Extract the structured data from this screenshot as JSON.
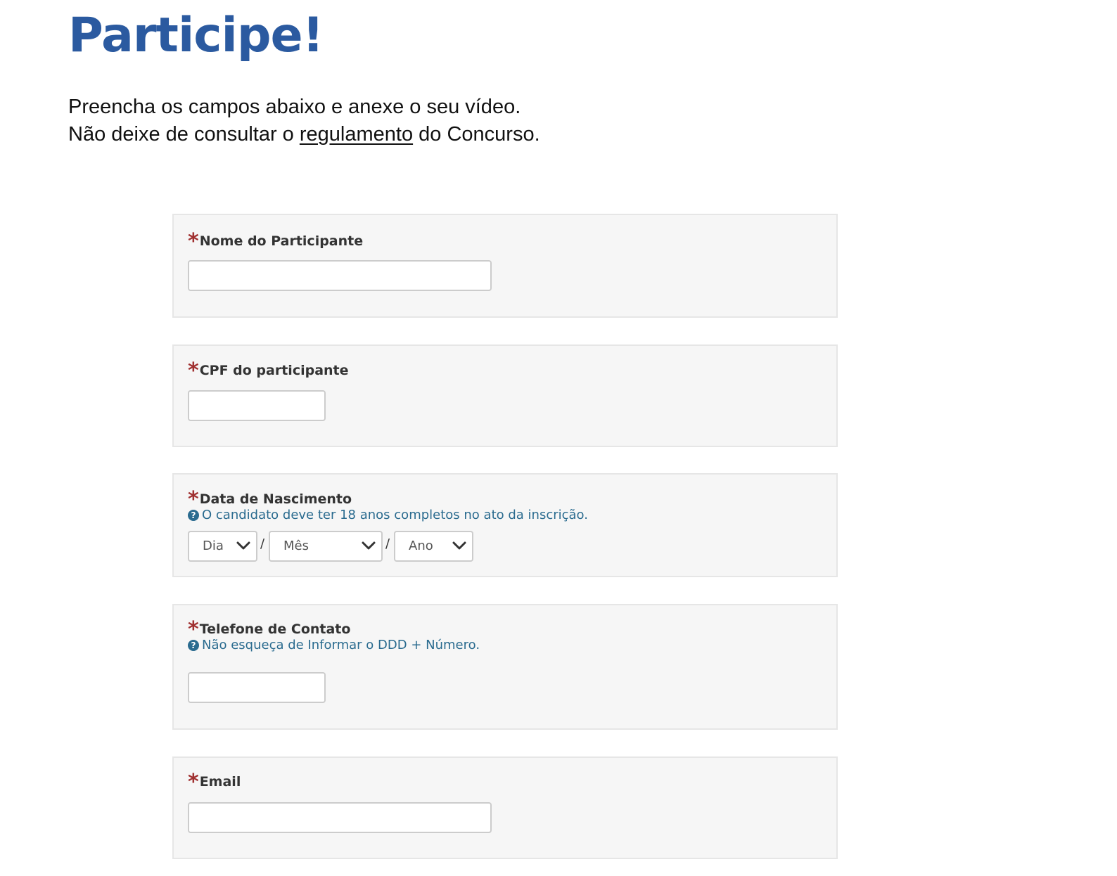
{
  "page": {
    "title": "Participe!",
    "intro_line1": "Preencha os campos abaixo e anexe o seu vídeo.",
    "intro_line2_prefix": "Não deixe de consultar o ",
    "intro_line2_link": "regulamento",
    "intro_line2_suffix": " do Concurso."
  },
  "form": {
    "required_marker": "*",
    "help_icon": "question-circle-icon",
    "fields": {
      "nome": {
        "label": "Nome do Participante",
        "value": ""
      },
      "cpf": {
        "label": "CPF do participante",
        "value": ""
      },
      "nascimento": {
        "label": "Data de Nascimento",
        "help": "O candidato deve ter 18 anos completos no ato da inscrição.",
        "day": "Dia",
        "month": "Mês",
        "year": "Ano",
        "separator": "/"
      },
      "telefone": {
        "label": "Telefone de Contato",
        "help": "Não esqueça de Informar o DDD + Número.",
        "value": ""
      },
      "email": {
        "label": "Email",
        "value": ""
      }
    }
  },
  "colors": {
    "title": "#2b5aa0",
    "required": "#a03030",
    "help_text": "#2a6b8f",
    "field_background": "#f6f6f6"
  }
}
